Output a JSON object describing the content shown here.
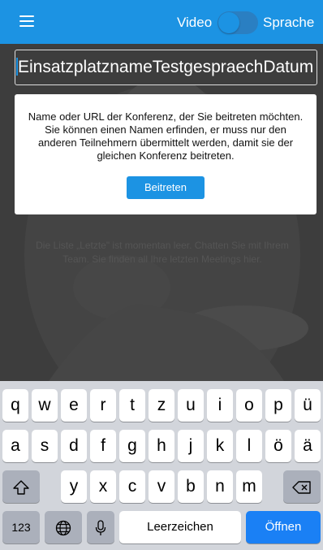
{
  "header": {
    "video_label": "Video",
    "language_label": "Sprache",
    "video_toggle_on": false
  },
  "conference": {
    "input_value": "EinsatzplatznameTestgespraechDatum",
    "info_text": "Name oder URL der Konferenz, der Sie beitreten möchten. Sie können einen Namen erfinden, er muss nur den anderen Teilnehmern übermittelt werden, damit sie der gleichen Konferenz beitreten.",
    "join_label": "Beitreten"
  },
  "recent": {
    "empty_text": "Die Liste „Letzte\" ist momentan leer. Chatten Sie mit Ihrem Team. Sie finden all Ihre letzten Meetings hier."
  },
  "keyboard": {
    "row1": [
      "q",
      "w",
      "e",
      "r",
      "t",
      "z",
      "u",
      "i",
      "o",
      "p",
      "ü"
    ],
    "row2": [
      "a",
      "s",
      "d",
      "f",
      "g",
      "h",
      "j",
      "k",
      "l",
      "ö",
      "ä"
    ],
    "row3": [
      "y",
      "x",
      "c",
      "v",
      "b",
      "n",
      "m"
    ],
    "numbers_label": "123",
    "space_label": "Leerzeichen",
    "open_label": "Öffnen",
    "icons": {
      "shift": "shift-icon",
      "backspace": "backspace-icon",
      "globe": "globe-icon",
      "mic": "microphone-icon"
    }
  },
  "colors": {
    "accent": "#1c93e3",
    "open_key": "#1a80f5"
  }
}
